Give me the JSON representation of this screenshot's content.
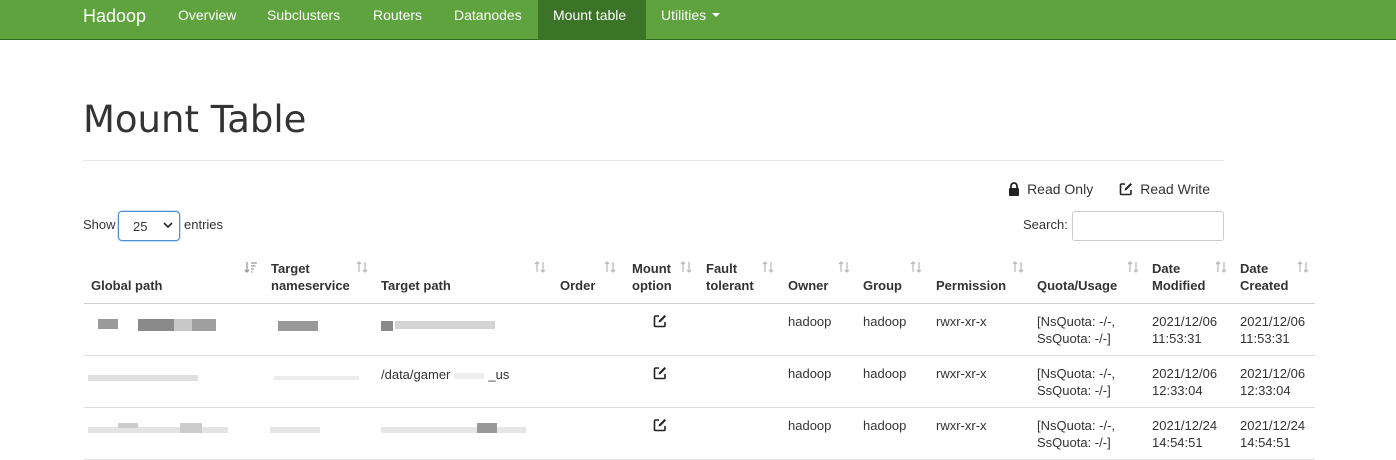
{
  "nav": {
    "brand": "Hadoop",
    "items": [
      {
        "label": "Overview"
      },
      {
        "label": "Subclusters"
      },
      {
        "label": "Routers"
      },
      {
        "label": "Datanodes"
      },
      {
        "label": "Mount table",
        "active": true
      },
      {
        "label": "Utilities",
        "dropdown": true
      }
    ]
  },
  "page": {
    "title": "Mount Table"
  },
  "legend": {
    "read_only": "Read Only",
    "read_write": "Read Write"
  },
  "controls": {
    "show_label": "Show",
    "entries_value": "25",
    "entries_label": "entries",
    "search_label": "Search:",
    "search_value": ""
  },
  "table": {
    "columns": [
      {
        "label": "Global path",
        "sort": "asc"
      },
      {
        "label": "Target nameservice",
        "sort": "both"
      },
      {
        "label": "Target path",
        "sort": "both"
      },
      {
        "label": "Order",
        "sort": "both"
      },
      {
        "label": "Mount option",
        "sort": "both"
      },
      {
        "label": "Fault tolerant",
        "sort": "both"
      },
      {
        "label": "Owner",
        "sort": "both"
      },
      {
        "label": "Group",
        "sort": "both"
      },
      {
        "label": "Permission",
        "sort": "both"
      },
      {
        "label": "Quota/Usage",
        "sort": "both"
      },
      {
        "label": "Date Modified",
        "sort": "both"
      },
      {
        "label": "Date Created",
        "sort": "both"
      }
    ],
    "rows": [
      {
        "global_path": "",
        "target_nameservice": "",
        "target_path": "",
        "order": "",
        "mount_option": "read-write-icon",
        "fault_tolerant": "",
        "owner": "hadoop",
        "group": "hadoop",
        "permission": "rwxr-xr-x",
        "quota_line1": "[NsQuota: -/-,",
        "quota_line2": "SsQuota: -/-]",
        "date_modified_date": "2021/12/06",
        "date_modified_time": "11:53:31",
        "date_created_date": "2021/12/06",
        "date_created_time": "11:53:31"
      },
      {
        "global_path": "",
        "target_nameservice": "",
        "target_path": "/data/gamer",
        "target_path_suffix": "_us",
        "order": "",
        "mount_option": "read-write-icon",
        "fault_tolerant": "",
        "owner": "hadoop",
        "group": "hadoop",
        "permission": "rwxr-xr-x",
        "quota_line1": "[NsQuota: -/-,",
        "quota_line2": "SsQuota: -/-]",
        "date_modified_date": "2021/12/06",
        "date_modified_time": "12:33:04",
        "date_created_date": "2021/12/06",
        "date_created_time": "12:33:04"
      },
      {
        "global_path": "",
        "target_nameservice": "",
        "target_path": "",
        "order": "",
        "mount_option": "read-write-icon",
        "fault_tolerant": "",
        "owner": "hadoop",
        "group": "hadoop",
        "permission": "rwxr-xr-x",
        "quota_line1": "[NsQuota: -/-,",
        "quota_line2": "SsQuota: -/-]",
        "date_modified_date": "2021/12/24",
        "date_modified_time": "14:54:51",
        "date_created_date": "2021/12/24",
        "date_created_time": "14:54:51"
      }
    ]
  },
  "colors": {
    "navbar": "#5fa33e",
    "navbar_active": "#3b7327",
    "select_focus": "#4a8fd8",
    "redaction": "#9a9a9a"
  }
}
